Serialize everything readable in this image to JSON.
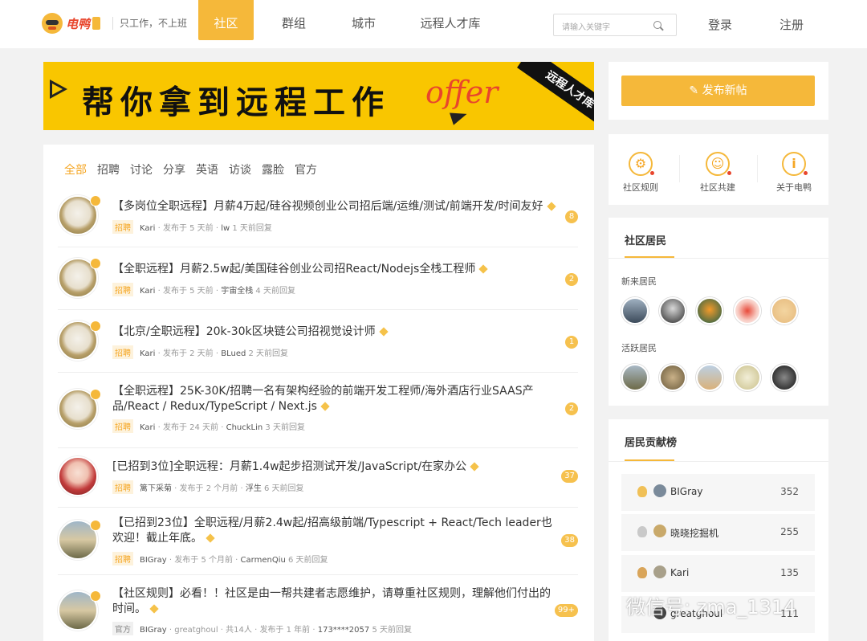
{
  "header": {
    "brand": "电鸭",
    "slogan": "只工作，不上班",
    "nav": [
      "社区",
      "群组",
      "城市",
      "远程人才库"
    ],
    "search_placeholder": "请输入关键字",
    "login": "登录",
    "register": "注册"
  },
  "banner": {
    "text": "帮你拿到远程工作",
    "offer": "offer",
    "ribbon": "远程人才库"
  },
  "tabs": [
    "全部",
    "招聘",
    "讨论",
    "分享",
    "英语",
    "访谈",
    "露脸",
    "官方"
  ],
  "posts": [
    {
      "title": "【多岗位全职远程】月薪4万起/硅谷视频创业公司招后端/运维/测试/前端开发/时间友好",
      "tag": "招聘",
      "author": "Kari",
      "posted": "发布于 5 天前",
      "replier": "lw",
      "replied": "1 天前回复",
      "count": "8"
    },
    {
      "title": "【全职远程】月薪2.5w起/美国硅谷创业公司招React/Nodejs全栈工程师",
      "tag": "招聘",
      "author": "Kari",
      "posted": "发布于 5 天前",
      "replier": "宇宙全栈",
      "replied": "4 天前回复",
      "count": "2"
    },
    {
      "title": "【北京/全职远程】20k-30k区块链公司招视觉设计师",
      "tag": "招聘",
      "author": "Kari",
      "posted": "发布于 2 天前",
      "replier": "BLued",
      "replied": "2 天前回复",
      "count": "1"
    },
    {
      "title": "【全职远程】25K-30K/招聘一名有架构经验的前端开发工程师/海外酒店行业SAAS产品/React / Redux/TypeScript / Next.js",
      "tag": "招聘",
      "author": "Kari",
      "posted": "发布于 24 天前",
      "replier": "ChuckLin",
      "replied": "3 天前回复",
      "count": "2"
    },
    {
      "title": "[已招到3位]全职远程：月薪1.4w起步招测试开发/JavaScript/在家办公",
      "tag": "招聘",
      "author": "篱下采菊",
      "posted": "发布于 2 个月前",
      "replier": "浮生",
      "replied": "6 天前回复",
      "count": "37"
    },
    {
      "title": "【已招到23位】全职远程/月薪2.4w起/招高级前端/Typescript + React/Tech leader也欢迎！截止年底。",
      "tag": "招聘",
      "author": "BIGray",
      "posted": "发布于 5 个月前",
      "replier": "CarmenQiu",
      "replied": "6 天前回复",
      "count": "38"
    },
    {
      "title": "【社区规则】必看！！社区是由一帮共建者志愿维护，请尊重社区规则，理解他们付出的时间。",
      "tag": "官方",
      "author": "BIGray",
      "extra": "greatghoul · 共14人",
      "posted": "发布于 1 年前",
      "replier": "173****2057",
      "replied": "5 天前回复",
      "count": "99+"
    }
  ],
  "sidebar": {
    "publish": "发布新帖",
    "links": [
      "社区规则",
      "社区共建",
      "关于电鸭"
    ],
    "residents_title": "社区居民",
    "new_label": "新来居民",
    "active_label": "活跃居民",
    "rank_title": "居民贡献榜",
    "ranks": [
      {
        "name": "BIGray",
        "score": "352"
      },
      {
        "name": "晓晓挖掘机",
        "score": "255"
      },
      {
        "name": "Kari",
        "score": "135"
      },
      {
        "name": "greatghoul",
        "score": "111"
      }
    ]
  },
  "watermark": "微信号: zma_1314",
  "colors": {
    "accent": "#f5b83a",
    "banner": "#f9c600",
    "brand_red": "#e8452c"
  }
}
